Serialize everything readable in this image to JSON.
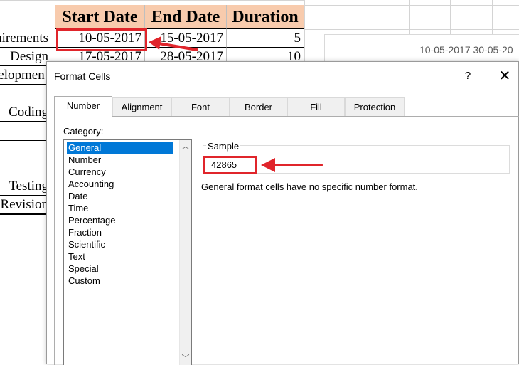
{
  "sheet": {
    "headers": [
      "Start Date",
      "End Date",
      "Duration"
    ],
    "tasks": [
      "Requirements",
      "Design",
      "Development",
      "Coding",
      "",
      "",
      "",
      "Testing",
      "Revision"
    ],
    "rows": [
      {
        "start": "10-05-2017",
        "end": "15-05-2017",
        "duration": "5"
      },
      {
        "start": "17-05-2017",
        "end": "28-05-2017",
        "duration": "10"
      }
    ],
    "chart_axis_labels": "10-05-2017  30-05-20"
  },
  "dialog": {
    "title": "Format Cells",
    "help_label": "?",
    "close_label": "✕",
    "tabs": [
      "Number",
      "Alignment",
      "Font",
      "Border",
      "Fill",
      "Protection"
    ],
    "active_tab": "Number",
    "category_label": "Category:",
    "categories": [
      "General",
      "Number",
      "Currency",
      "Accounting",
      "Date",
      "Time",
      "Percentage",
      "Fraction",
      "Scientific",
      "Text",
      "Special",
      "Custom"
    ],
    "selected_category": "General",
    "sample_label": "Sample",
    "sample_value": "42865",
    "description": "General format cells have no specific number format."
  },
  "icons": {
    "help": "help-icon",
    "close": "close-icon",
    "scroll_up": "chevron-up-icon",
    "scroll_down": "chevron-down-icon"
  },
  "colors": {
    "header_fill": "#f8cbad",
    "highlight": "#e0252b",
    "selection": "#0078d7"
  }
}
